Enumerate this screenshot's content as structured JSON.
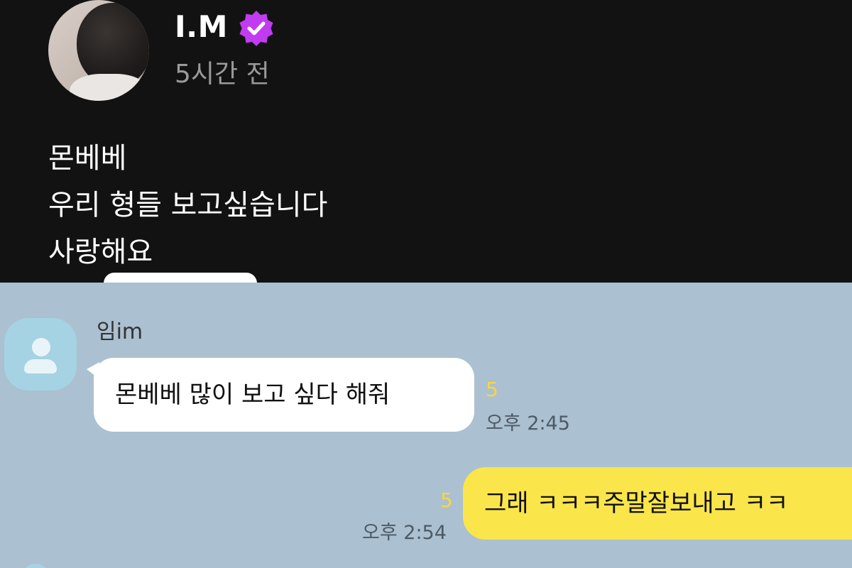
{
  "post": {
    "author": "I.M",
    "verified_badge_color": "#c13cf0",
    "verified_icon": "check-badge-icon",
    "time_ago": "5시간 전",
    "lines": [
      "몬베베",
      "우리 형들 보고싶습니다",
      "사랑해요"
    ]
  },
  "chat": {
    "background_color": "#abc0d0",
    "sender_name": "임im",
    "incoming": {
      "text": "몬베베 많이 보고 싶다 해줘",
      "unread": "5",
      "time": "오후 2:45"
    },
    "outgoing": {
      "text": "그래 ㅋㅋㅋ주말잘보내고 ㅋㅋ",
      "unread": "5",
      "time": "오후 2:54",
      "bubble_color": "#fae54b"
    }
  }
}
